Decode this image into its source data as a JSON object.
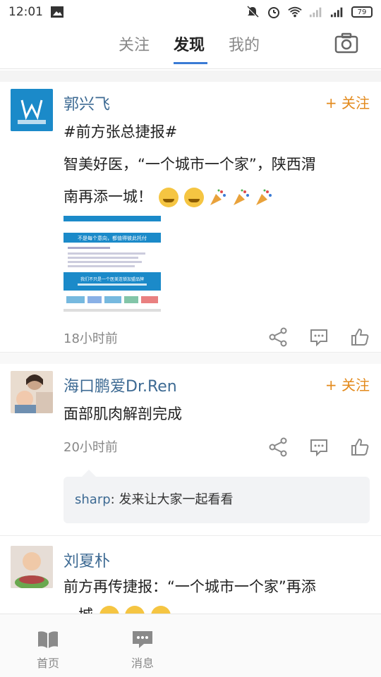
{
  "status_bar": {
    "time": "12:01",
    "battery": "79"
  },
  "top_tabs": [
    {
      "label": "关注"
    },
    {
      "label": "发现"
    },
    {
      "label": "我的"
    }
  ],
  "posts": [
    {
      "author": "郭兴飞",
      "follow_label": "+ 关注",
      "line1": "#前方张总捷报#",
      "line2": "智美好医，“一个城市一个家”，陕西渭",
      "line3": "南再添一城！",
      "image_caption": "不是每个意向，都值得彼此托付",
      "image_sub": "我们不只是一个医美连锁加盟品牌",
      "time": "18小时前"
    },
    {
      "author": "海口鹏爱Dr.Ren",
      "follow_label": "+ 关注",
      "text": "面部肌肉解剖完成",
      "time": "20小时前",
      "comment_name": "sharp",
      "comment_text": "发来让大家一起看看"
    },
    {
      "author": "刘夏朴",
      "line1": "前方再传捷报：“一个城市一个家”再添",
      "line2": "一城"
    }
  ],
  "bottom_nav": [
    {
      "label": "首页",
      "icon": "book-icon"
    },
    {
      "label": "消息",
      "icon": "message-icon"
    }
  ],
  "colors": {
    "accent": "#3a7bd5",
    "name": "#3d6a93",
    "follow": "#e38a1c"
  }
}
